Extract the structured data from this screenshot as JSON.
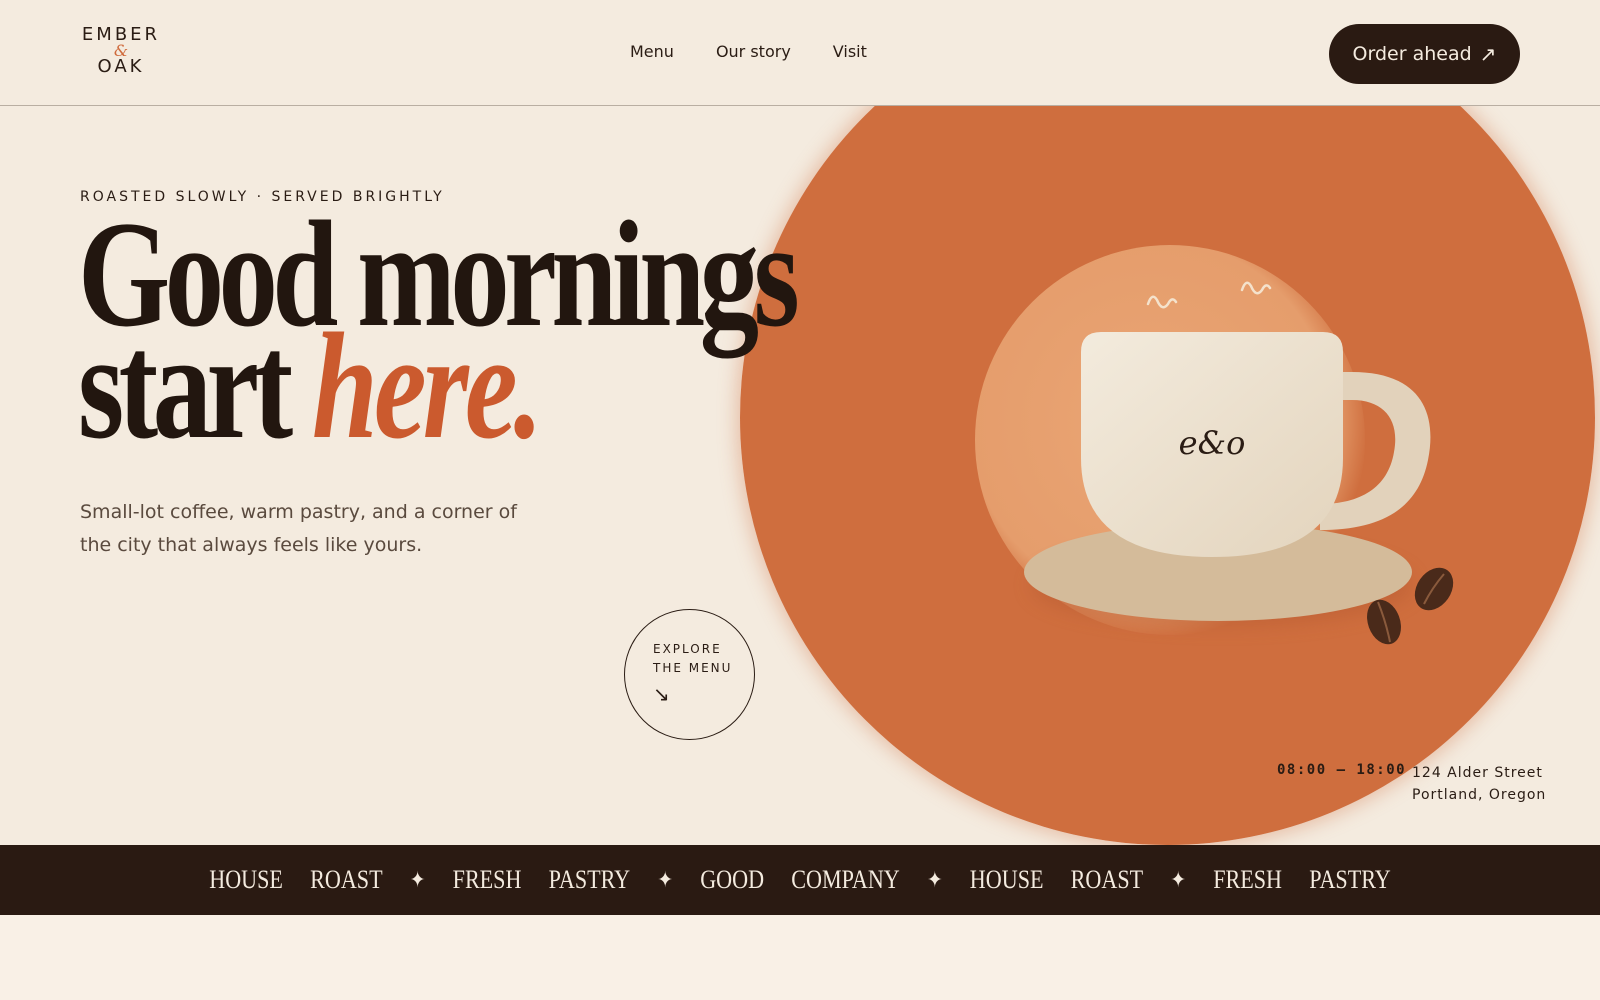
{
  "brand": {
    "line1": "EMBER",
    "amp": "&",
    "line2": "OAK"
  },
  "nav": {
    "items": [
      "Menu",
      "Our story",
      "Visit"
    ]
  },
  "header": {
    "cta_label": "Order ahead",
    "cta_icon": "arrow-up-right-icon"
  },
  "hero": {
    "eyebrow": "ROASTED SLOWLY · SERVED BRIGHTLY",
    "headline_line1": "Good mornings",
    "headline_line2_plain": "start",
    "headline_line2_accent": "here.",
    "subcopy": "Small-lot coffee, warm pastry, and a corner of the city that always feels like yours.",
    "explore_line1": "EXPLORE",
    "explore_line2": "THE MENU",
    "explore_icon": "arrow-down-right-icon"
  },
  "cup": {
    "monogram": "e&o"
  },
  "info": {
    "hours": "08:00 — 18:00",
    "address_line1": "124 Alder Street",
    "address_line2": "Portland, Oregon"
  },
  "ticker": {
    "groups": [
      [
        "HOUSE",
        "ROAST"
      ],
      [
        "FRESH",
        "PASTRY"
      ],
      [
        "GOOD",
        "COMPANY"
      ],
      [
        "HOUSE",
        "ROAST"
      ],
      [
        "FRESH",
        "PASTRY"
      ]
    ],
    "separator_icon": "four-point-star-icon",
    "separator": "✦"
  },
  "colors": {
    "background": "#f4ebdf",
    "accent": "#cf6e3e",
    "dark": "#2a1a12",
    "cup": "#efe4d3"
  }
}
